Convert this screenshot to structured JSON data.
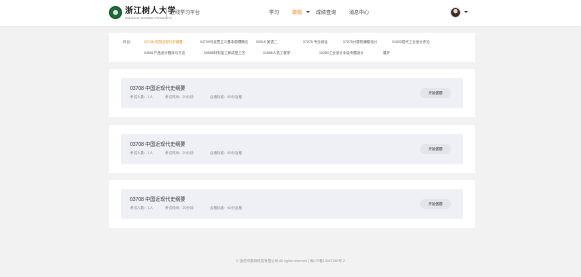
{
  "header": {
    "logo_name": "浙江树人大学",
    "logo_sub": "ZHEJIANG SHUREN UNIVERSITY",
    "platform_name": "在线学习平台",
    "nav": [
      {
        "label": "学习",
        "active": false
      },
      {
        "label": "做题",
        "active": true
      },
      {
        "label": "成绩查询",
        "active": false
      },
      {
        "label": "消息中心",
        "active": false
      }
    ]
  },
  "filter": {
    "label": "科目：",
    "tags": [
      "03708 中国近现代史纲要",
      "03709马克思主义基本原理概论",
      "00015 英语二",
      "07076 专业综合",
      "07075计算机辅助设计",
      "01603现代工业设计史论",
      "04651产品设计程序与方法",
      "00688材料加工和成型工艺",
      "01656人机工程学",
      "10284工业设计手绘专题设计",
      "展开"
    ]
  },
  "courses": [
    {
      "title": "03708 中国近现代史纲要",
      "count": "考试人数：1人",
      "duration": "考试时间：20分钟",
      "pass": "合格标准：60分及格",
      "action": "开始做题"
    },
    {
      "title": "03708 中国近现代史纲要",
      "count": "考试人数：1人",
      "duration": "考试时间：20分钟",
      "pass": "合格标准：60分及格",
      "action": "开始做题"
    },
    {
      "title": "03708 中国近现代史纲要",
      "count": "考试人数：1人",
      "duration": "考试时间：20分钟",
      "pass": "合格标准：60分及格",
      "action": "开始做题"
    }
  ],
  "footer": "© 浙西市数网科技有限公司 All rights reserved | 粤ICP备13047180号-2",
  "colors": {
    "accent": "#f08a24",
    "brand": "#1f6b3a"
  }
}
